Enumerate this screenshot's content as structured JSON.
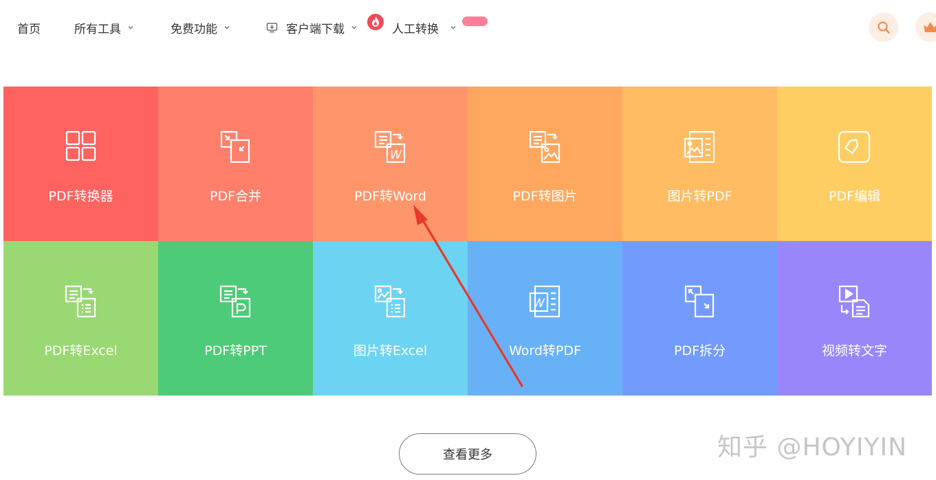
{
  "nav": {
    "items": [
      {
        "label": "首页"
      },
      {
        "label": "所有工具"
      },
      {
        "label": "免费功能"
      },
      {
        "label": "客户端下载"
      },
      {
        "label": "人工转换"
      }
    ],
    "search_icon": "search-icon",
    "crown_icon": "crown-icon",
    "accent": "#f28c4c"
  },
  "tools": [
    {
      "label": "PDF转换器",
      "icon": "grid-icon",
      "color": "#fe6360"
    },
    {
      "label": "PDF合并",
      "icon": "merge-icon",
      "color": "#ff7f6b"
    },
    {
      "label": "PDF转Word",
      "icon": "pdf-to-word-icon",
      "color": "#ff966b"
    },
    {
      "label": "PDF转图片",
      "icon": "pdf-to-image-icon",
      "color": "#ffa75f"
    },
    {
      "label": "图片转PDF",
      "icon": "image-to-pdf-icon",
      "color": "#ffbc62"
    },
    {
      "label": "PDF编辑",
      "icon": "edit-icon",
      "color": "#ffce63"
    },
    {
      "label": "PDF转Excel",
      "icon": "pdf-to-excel-icon",
      "color": "#99d872"
    },
    {
      "label": "PDF转PPT",
      "icon": "pdf-to-ppt-icon",
      "color": "#4ecb78"
    },
    {
      "label": "图片转Excel",
      "icon": "image-to-excel-icon",
      "color": "#6dd3f2"
    },
    {
      "label": "Word转PDF",
      "icon": "word-to-pdf-icon",
      "color": "#69b1f6"
    },
    {
      "label": "PDF拆分",
      "icon": "split-icon",
      "color": "#739bfd"
    },
    {
      "label": "视频转文字",
      "icon": "video-to-text-icon",
      "color": "#9a86fb"
    }
  ],
  "more_button": {
    "label": "查看更多"
  },
  "watermark": {
    "text": "知乎 @HOYIYIN"
  },
  "annotation": {
    "color": "#e8392b"
  }
}
